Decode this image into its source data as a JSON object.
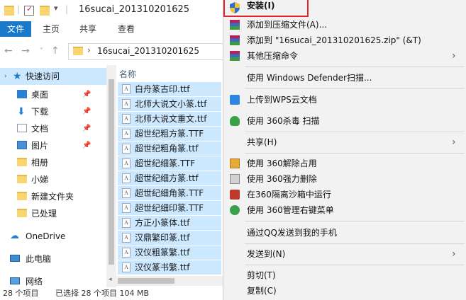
{
  "window": {
    "title": "16sucai_201310201625"
  },
  "ribbon": {
    "tabs": [
      "文件",
      "主页",
      "共享",
      "查看"
    ]
  },
  "address": {
    "path": "16sucai_201310201625"
  },
  "nav": {
    "items": [
      {
        "label": "快速访问"
      },
      {
        "label": "桌面"
      },
      {
        "label": "下载"
      },
      {
        "label": "文档"
      },
      {
        "label": "图片"
      },
      {
        "label": "相册"
      },
      {
        "label": "小娣"
      },
      {
        "label": "新建文件夹"
      },
      {
        "label": "已处理"
      },
      {
        "label": "OneDrive"
      },
      {
        "label": "此电脑"
      },
      {
        "label": "网络"
      }
    ]
  },
  "list": {
    "column_name": "名称",
    "files": [
      "白舟篆古印.ttf",
      "北师大说文小篆.ttf",
      "北师大说文重文.ttf",
      "超世纪粗方篆.TTF",
      "超世纪粗角篆.ttf",
      "超世纪细篆.TTF",
      "超世纪细方篆.ttf",
      "超世纪细角篆.TTF",
      "超世纪细印篆.TTF",
      "方正小篆体.ttf",
      "汉鼎繁印篆.ttf",
      "汉仪粗篆繁.ttf",
      "汉仪篆书繁.ttf"
    ]
  },
  "status": {
    "count": "28 个项目",
    "selected": "已选择 28 个项目 104 MB"
  },
  "context_menu": {
    "install": "安装(I)",
    "add_archive": "添加到压缩文件(A)...",
    "add_zip": "添加到 \"16sucai_201310201625.zip\" (&T)",
    "other_compress": "其他压缩命令",
    "defender": "使用 Windows Defender扫描...",
    "wps_upload": "上传到WPS云文档",
    "scan_360": "使用 360杀毒 扫描",
    "share": "共享(H)",
    "unlock_360": "使用 360解除占用",
    "force_delete_360": "使用 360强力删除",
    "sandbox_360": "在360隔离沙箱中运行",
    "manage_360": "使用 360管理右键菜单",
    "qq_send": "通过QQ发送到我的手机",
    "send_to": "发送到(N)",
    "cut": "剪切(T)",
    "copy": "复制(C)"
  },
  "colors": {
    "accent": "#1979ca",
    "selection": "#cce8ff",
    "highlight_box": "#e3242b"
  }
}
